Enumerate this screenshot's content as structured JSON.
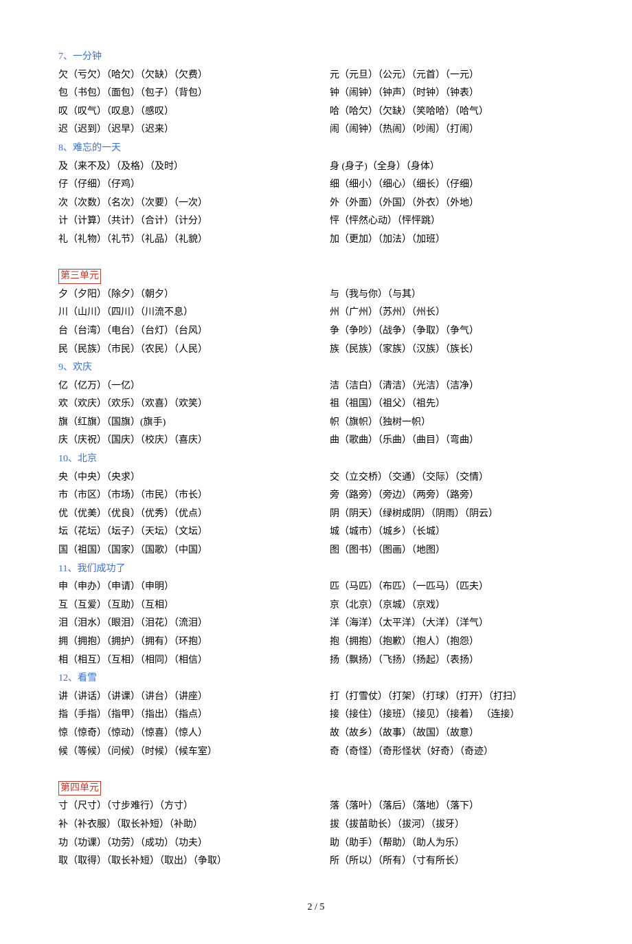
{
  "sections": [
    {
      "left": "7、一分钟",
      "leftClass": "sec-blue",
      "right": ""
    },
    {
      "left": "欠（亏欠）（哈欠）（欠缺）（欠费）",
      "right": "元（元旦）（公元）（元首）（一元）"
    },
    {
      "left": "包（书包）（面包）（包子）（背包）",
      "right": "钟（闹钟）（钟声）（时钟）（钟表）"
    },
    {
      "left": "叹（叹气）（叹息）（感叹）",
      "right": "哈（哈欠）（欠缺）（笑哈哈）（哈气）"
    },
    {
      "left": "迟（迟到）（迟早）（迟来）",
      "right": "闹（闹钟）（热闹）（吵闹）（打闹）"
    },
    {
      "left": "8、难忘的一天",
      "leftClass": "sec-blue",
      "right": ""
    },
    {
      "left": "及（来不及）（及格）（及时）",
      "right": "身 (身子)（全身）（身体）"
    },
    {
      "left": "仔（仔细）（仔鸡）",
      "right": "细（细小）（细心）（细长）（仔细）"
    },
    {
      "left": "次（次数）（名次）（次要）（一次）",
      "right": "外（外面）（外国）（外衣）（外地）"
    },
    {
      "left": "计（计算）（共计）（合计）（计分）",
      "right": "怦（怦然心动）（怦怦跳）"
    },
    {
      "left": "礼（礼物）（礼节）（礼品）（礼貌）",
      "right": "加（更加）（加法）（加班）"
    },
    {
      "left": " ",
      "right": " "
    },
    {
      "left": "第三单元",
      "leftClass": "sec-red",
      "right": ""
    },
    {
      "left": "夕（夕阳）（除夕）（朝夕）",
      "right": "与（我与你）（与其）"
    },
    {
      "left": "川（山川）（四川）（川流不息）",
      "right": "州（广州）（苏州）（州长）"
    },
    {
      "left": "台（台湾）（电台）（台灯）（台风）",
      "right": "争（争吵）（战争）（争取）（争气）"
    },
    {
      "left": "民（民族）（市民）（农民）（人民）",
      "right": "族（民族）（家族）（汉族）（族长）"
    },
    {
      "left": "9、欢庆",
      "leftClass": "sec-blue",
      "right": ""
    },
    {
      "left": "亿（亿万）（一亿）",
      "right": "洁（洁白）（清洁）（光洁）（洁净）"
    },
    {
      "left": "欢（欢庆）（欢乐）（欢喜）（欢笑）",
      "right": "祖（祖国）（祖父）（祖先）"
    },
    {
      "left": "旗（红旗）（国旗）(旗手)",
      "right": "帜（旗帜）（独树一帜）"
    },
    {
      "left": "庆（庆祝）（国庆）（校庆）（喜庆）",
      "right": "曲（歌曲）（乐曲）（曲目）（弯曲）"
    },
    {
      "left": "10、北京",
      "leftClass": "sec-blue",
      "right": ""
    },
    {
      "left": "央（中央）（央求）",
      "right": "交（立交桥）（交通）（交际）（交情）"
    },
    {
      "left": "市（市区）（市场）（市民）（市长）",
      "right": "旁（路旁）（旁边）（两旁）（路旁）"
    },
    {
      "left": "优（优美）（优良）（优秀）（优点）",
      "right": "阴（阴天）（绿树成阴）（阴雨）（阴云）"
    },
    {
      "left": "坛（花坛）（坛子）（天坛）（文坛）",
      "right": "城（城市）（城乡）（长城）"
    },
    {
      "left": "国（祖国）（国家）（国歌）（中国）",
      "right": "图（图书）（图画）（地图）"
    },
    {
      "left": "11、我们成功了",
      "leftClass": "sec-blue",
      "right": ""
    },
    {
      "left": "申（申办）（申请）（申明）",
      "right": "匹（马匹）（布匹）（一匹马）（匹夫）"
    },
    {
      "left": "互（互爱）（互助）（互相）",
      "right": "京（北京）（京城）（京戏）"
    },
    {
      "left": "泪（泪水）（眼泪）（泪花）（流泪）",
      "right": "洋（海洋）（太平洋）（大洋）（洋气）"
    },
    {
      "left": "拥（拥抱）（拥护）（拥有）（环抱）",
      "right": "抱（拥抱）（抱歉）（抱人）（抱怨）"
    },
    {
      "left": "相（相互）（互相）（相同）（相信）",
      "right": "扬（飘扬）（飞扬）（扬起）（表扬）"
    },
    {
      "left": "12、看雪",
      "leftClass": "sec-blue",
      "right": ""
    },
    {
      "left": "讲（讲话）（讲课）（讲台）（讲座）",
      "right": " 打（打雪仗）（打架）（打球）（打开）（打扫）"
    },
    {
      "left": "指（手指）（指甲）（指出）（指点）",
      "right": "接（接住）（接班）（接见）（接着）  （连接）"
    },
    {
      "left": "惊（惊奇）（惊动）（惊喜）（惊人）",
      "right": "故（故乡）（故事）（故国）（故意）"
    },
    {
      "left": "候（等候）（问候）（时候）（候车室）",
      "right": "奇（奇怪）（奇形怪状（好奇）（奇迹）"
    },
    {
      "left": " ",
      "right": " "
    },
    {
      "left": "第四单元",
      "leftClass": "sec-red",
      "right": ""
    },
    {
      "left": "寸（尺寸）（寸步难行）（方寸）",
      "right": "落（落叶）（落后）（落地）（落下）"
    },
    {
      "left": "补（补衣服）（取长补短）（补助）",
      "right": "拔（拔苗助长）（拔河）（拔牙）"
    },
    {
      "left": "功（功课）（功劳）（成功）（功夫）",
      "right": "助（助手）（帮助）（助人为乐）"
    },
    {
      "left": "取（取得）（取长补短）（取出）（争取）",
      "right": "所（所以）（所有）（寸有所长）"
    }
  ],
  "pagenum": "2 / 5"
}
